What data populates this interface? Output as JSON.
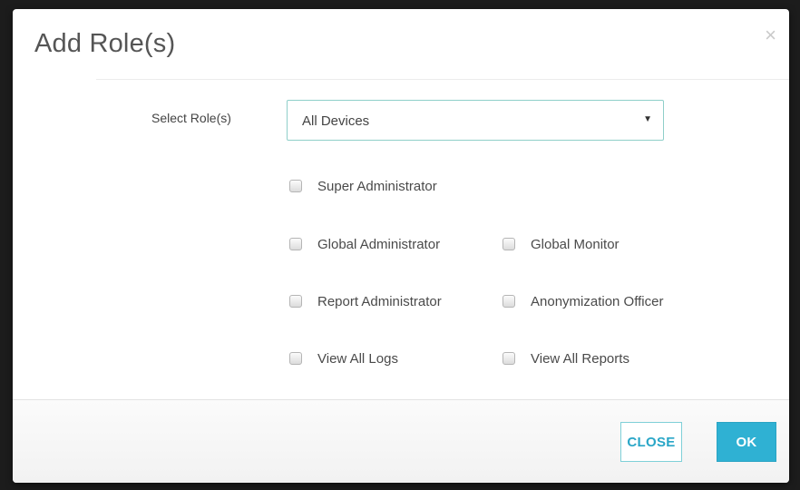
{
  "modal": {
    "title": "Add Role(s)",
    "close_icon": "×"
  },
  "form": {
    "select_label": "Select Role(s)",
    "select_value": "All Devices",
    "caret_icon": "▼"
  },
  "roles": [
    {
      "label": "Super Administrator",
      "checked": false
    },
    {
      "label": "Global Administrator",
      "checked": false
    },
    {
      "label": "Global Monitor",
      "checked": false
    },
    {
      "label": "Report Administrator",
      "checked": false
    },
    {
      "label": "Anonymization Officer",
      "checked": false
    },
    {
      "label": "View All Logs",
      "checked": false
    },
    {
      "label": "View All Reports",
      "checked": false
    }
  ],
  "footer": {
    "close_label": "CLOSE",
    "ok_label": "OK"
  },
  "colors": {
    "accent": "#2fb1d3",
    "select_border": "#8fcfc9"
  }
}
